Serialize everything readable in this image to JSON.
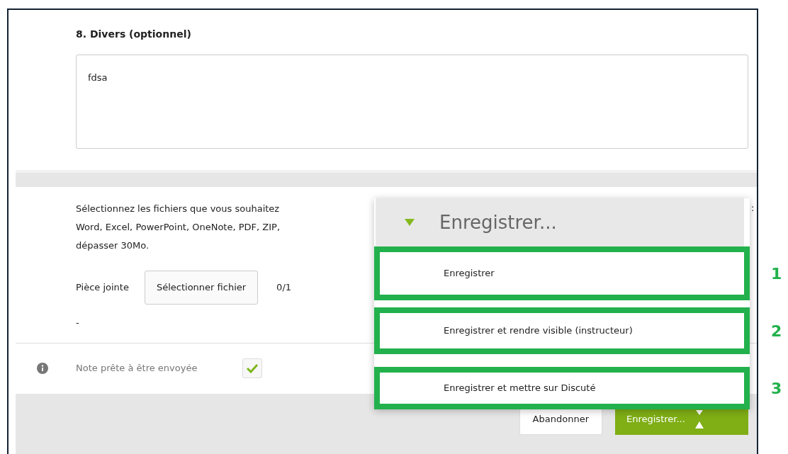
{
  "section": {
    "title": "8. Divers (optionnel)",
    "value": "fdsa"
  },
  "attachments": {
    "instructions": [
      "Sélectionnez les fichiers que vous souhaitez",
      "Word, Excel, PowerPoint, OneNote, PDF, ZIP,",
      "dépasser 30Mo."
    ],
    "instructions_end": ":",
    "label": "Pièce jointe",
    "button": "Sélectionner fichier",
    "count": "0/1",
    "list": "-"
  },
  "ready": {
    "label": "Note prête à être envoyée",
    "checked": true
  },
  "footer": {
    "cancel": "Abandonner",
    "save": "Enregistrer..."
  },
  "dropdown": {
    "expanded": true,
    "title": "Enregistrer...",
    "items": [
      {
        "label": "Enregistrer",
        "number": "1"
      },
      {
        "label": "Enregistrer et rendre visible (instructeur)",
        "number": "2"
      },
      {
        "label": "Enregistrer et mettre sur Discuté",
        "number": "3"
      }
    ]
  }
}
